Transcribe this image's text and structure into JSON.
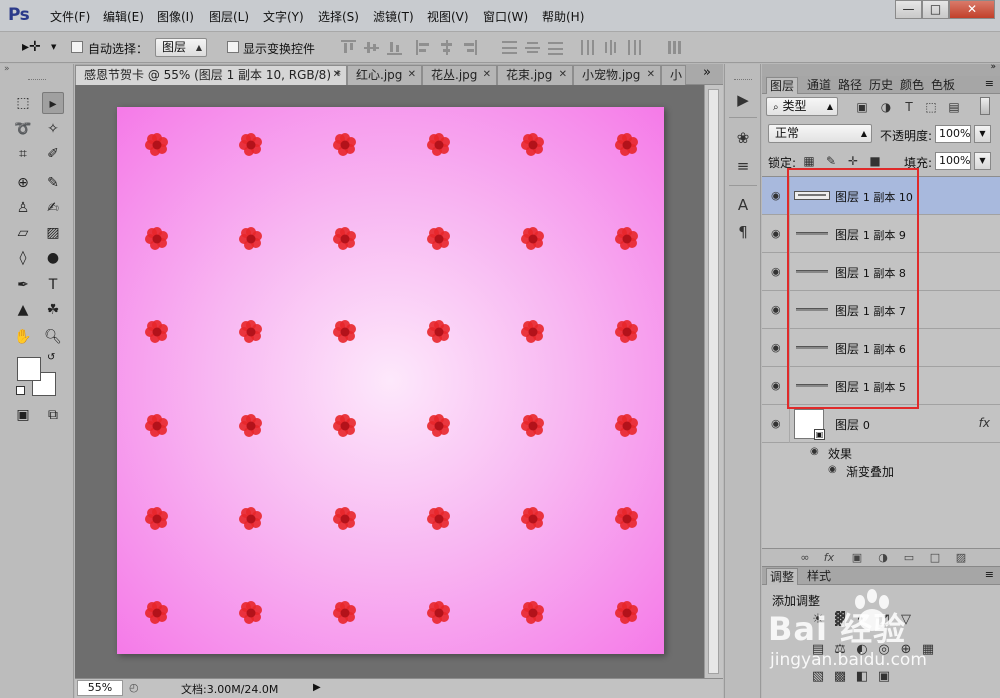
{
  "app": {
    "logo": "Ps"
  },
  "menu": [
    "文件(F)",
    "编辑(E)",
    "图像(I)",
    "图层(L)",
    "文字(Y)",
    "选择(S)",
    "滤镜(T)",
    "视图(V)",
    "窗口(W)",
    "帮助(H)"
  ],
  "window_controls": {
    "minimize": "—",
    "maximize": "□",
    "close": "✕"
  },
  "options": {
    "auto_select_label": "自动选择：",
    "auto_select_checked": false,
    "auto_select_target": "图层",
    "show_transform_label": "显示变换控件",
    "show_transform_checked": false
  },
  "tabs": [
    {
      "label": "感恩节贺卡 @ 55% (图层 1 副本 10, RGB/8) *",
      "active": true
    },
    {
      "label": "红心.jpg",
      "active": false
    },
    {
      "label": "花丛.jpg",
      "active": false
    },
    {
      "label": "花束.jpg",
      "active": false
    },
    {
      "label": "小宠物.jpg",
      "active": false
    },
    {
      "label": "小",
      "active": false
    }
  ],
  "tabs_overflow": "»",
  "canvas": {
    "gradient_center": "#fde8fb",
    "gradient_edge": "#f57ae8",
    "flower_color": "#e8262a",
    "flower_rows": 6,
    "flower_cols": 6
  },
  "status": {
    "zoom": "55%",
    "doc_info": "文档:3.00M/24.0M"
  },
  "panel_tabs": [
    "图层",
    "通道",
    "路径",
    "历史",
    "颜色",
    "色板"
  ],
  "layers_panel": {
    "filter_label": "类型",
    "blend_mode": "正常",
    "opacity_label": "不透明度:",
    "opacity_value": "100%",
    "lock_label": "锁定:",
    "fill_label": "填充:",
    "fill_value": "100%"
  },
  "layers": [
    {
      "name": "图层",
      "num": "1 副本 10",
      "selected": true
    },
    {
      "name": "图层",
      "num": "1 副本 9",
      "selected": false
    },
    {
      "name": "图层",
      "num": "1 副本 8",
      "selected": false
    },
    {
      "name": "图层",
      "num": "1 副本 7",
      "selected": false
    },
    {
      "name": "图层",
      "num": "1 副本 6",
      "selected": false
    },
    {
      "name": "图层",
      "num": "1 副本 5",
      "selected": false
    }
  ],
  "base_layer": {
    "name": "图层",
    "num": "0",
    "fx": "fx",
    "effects_label": "效果",
    "effect_item": "渐变叠加"
  },
  "adjust_tabs": [
    "调整",
    "样式"
  ],
  "adjust_title": "添加调整",
  "watermark": {
    "logo": "Bai 经验",
    "url": "jingyan.baidu.com"
  },
  "highlight_color": "#e02a2a",
  "selection_color": "#a8b9dd"
}
